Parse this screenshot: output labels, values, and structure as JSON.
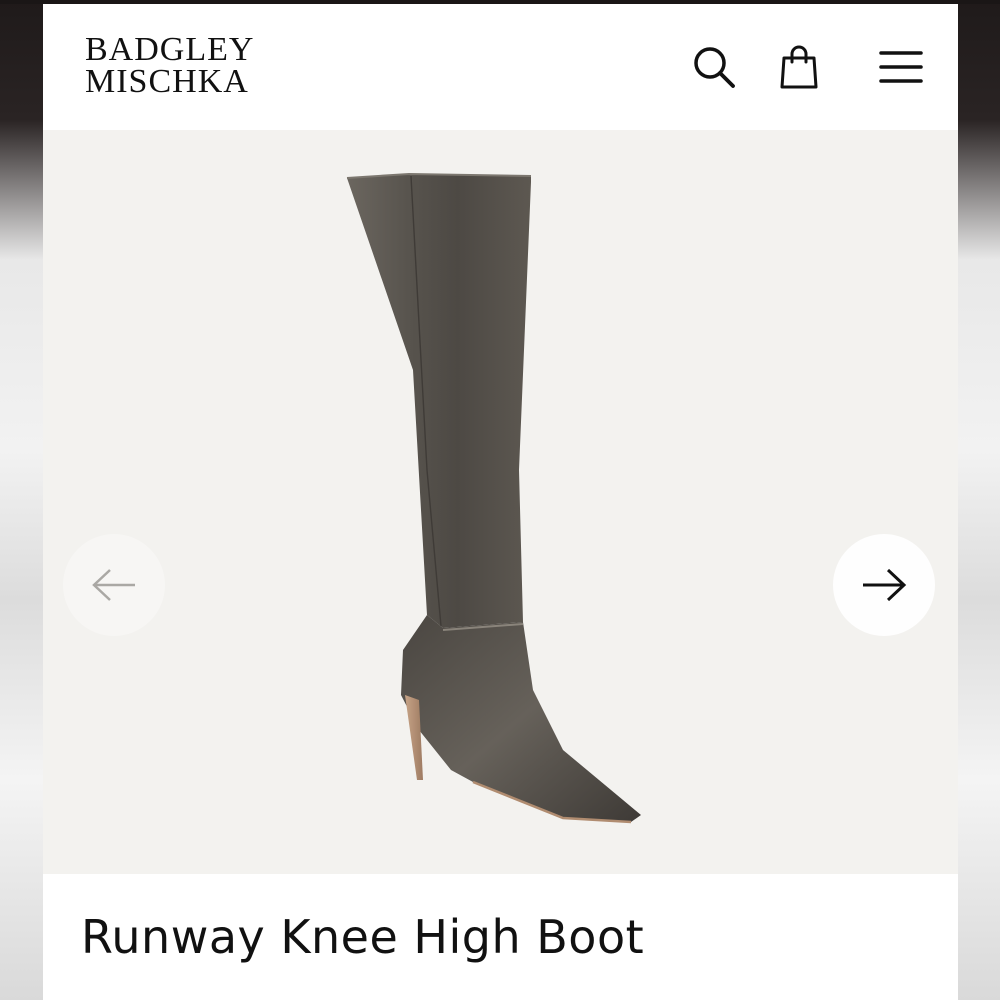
{
  "brand": {
    "line1": "BADGLEY",
    "line2": "MISCHKA"
  },
  "header": {
    "icons": [
      "search-icon",
      "shopping-bag-icon",
      "hamburger-menu-icon"
    ]
  },
  "gallery": {
    "prev_icon": "arrow-left-icon",
    "next_icon": "arrow-right-icon",
    "image_alt": "boot-image"
  },
  "product": {
    "title": "Runway Knee High Boot"
  },
  "colors": {
    "hero_background": "#f3f2ef",
    "boot": "#5e5a54",
    "text": "#111111"
  }
}
